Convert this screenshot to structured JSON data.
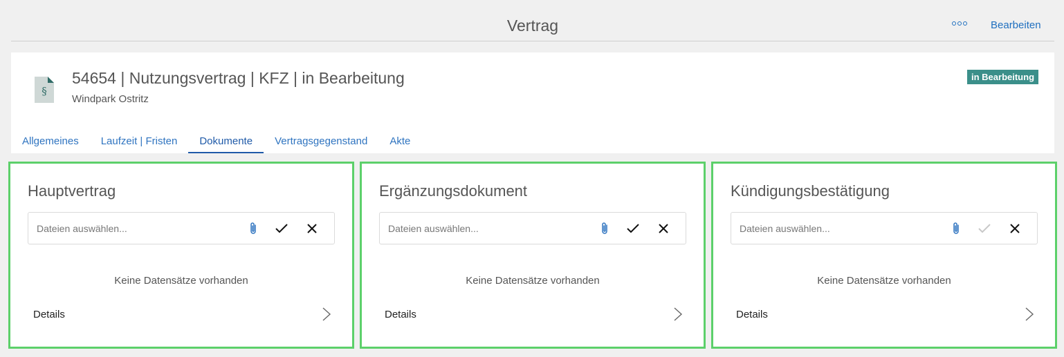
{
  "page": {
    "title": "Vertrag",
    "more_icon": "more-horizontal-icon",
    "edit_label": "Bearbeiten"
  },
  "record": {
    "icon": "contract-document-icon",
    "title": "54654 | Nutzungsvertrag | KFZ | in Bearbeitung",
    "subtitle": "Windpark Ostritz",
    "status": "in Bearbeitung",
    "status_color": "#3b8f8a"
  },
  "tabs": [
    {
      "label": "Allgemeines",
      "active": false
    },
    {
      "label": "Laufzeit | Fristen",
      "active": false
    },
    {
      "label": "Dokumente",
      "active": true
    },
    {
      "label": "Vertragsgegenstand",
      "active": false
    },
    {
      "label": "Akte",
      "active": false
    }
  ],
  "panels": [
    {
      "title": "Hauptvertrag",
      "placeholder": "Dateien auswählen...",
      "confirm_enabled": true,
      "empty": "Keine Datensätze vorhanden",
      "details": "Details"
    },
    {
      "title": "Ergänzungsdokument",
      "placeholder": "Dateien auswählen...",
      "confirm_enabled": true,
      "empty": "Keine Datensätze vorhanden",
      "details": "Details"
    },
    {
      "title": "Kündigungsbestätigung",
      "placeholder": "Dateien auswählen...",
      "confirm_enabled": false,
      "empty": "Keine Datensätze vorhanden",
      "details": "Details"
    }
  ],
  "colors": {
    "accent": "#1f6fbf",
    "highlight_border": "#5cd06a"
  }
}
